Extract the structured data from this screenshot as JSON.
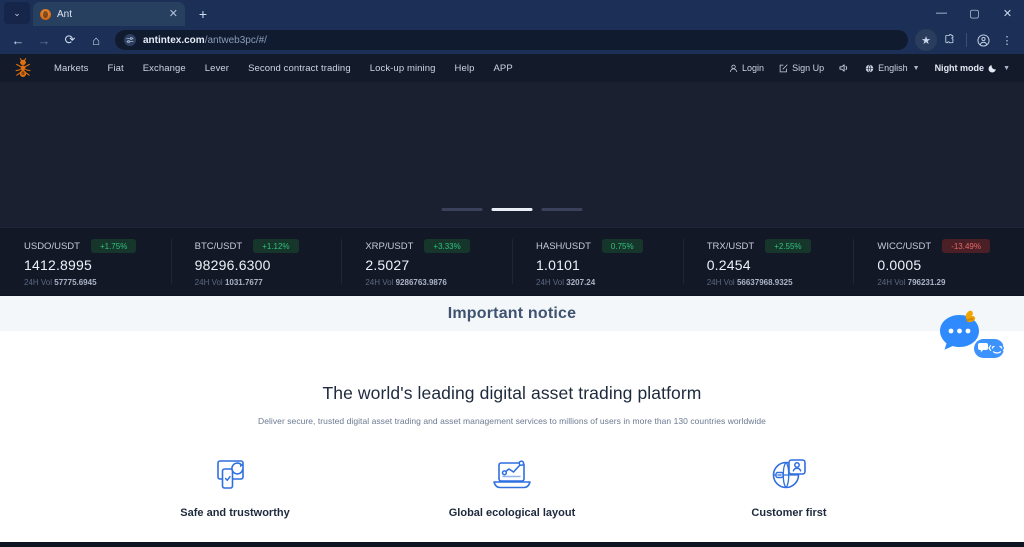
{
  "browser": {
    "tab": {
      "title": "Ant",
      "favicon": "ant-favicon",
      "close": "✕"
    },
    "tab_list_btn": "⌄",
    "new_tab": "+",
    "window_controls": {
      "minimize": "—",
      "maximize": "▢",
      "close": "✕"
    },
    "nav": {
      "back": "←",
      "forward": "→",
      "reload": "⟳",
      "home": "⌂"
    },
    "omnibox": {
      "site_controls_icon": "tune-icon",
      "url_domain": "antintex.com",
      "url_path": "/antweb3pc/#/"
    },
    "toolbar": {
      "bookmark": "★",
      "extensions": "puzzle-icon",
      "profile": "profile-icon",
      "menu": "⋮"
    }
  },
  "site": {
    "logo_alt": "ant-logo",
    "nav_links": [
      "Markets",
      "Fiat",
      "Exchange",
      "Lever",
      "Second contract trading",
      "Lock-up mining",
      "Help",
      "APP"
    ],
    "header_right": {
      "login": "Login",
      "signup": "Sign Up",
      "sound_icon": "speaker-icon",
      "language": "English",
      "night_mode": "Night mode"
    }
  },
  "hero": {
    "carousel": {
      "count": 3,
      "active_index": 1
    }
  },
  "tickers": [
    {
      "pair": "USDO/USDT",
      "change": "+1.75%",
      "direction": "up",
      "price": "1412.8995",
      "vol_label": "24H Vol",
      "vol": "57775.6945"
    },
    {
      "pair": "BTC/USDT",
      "change": "+1.12%",
      "direction": "up",
      "price": "98296.6300",
      "vol_label": "24H Vol",
      "vol": "1031.7677"
    },
    {
      "pair": "XRP/USDT",
      "change": "+3.33%",
      "direction": "up",
      "price": "2.5027",
      "vol_label": "24H Vol",
      "vol": "9286763.9876"
    },
    {
      "pair": "HASH/USDT",
      "change": "0.75%",
      "direction": "up",
      "price": "1.0101",
      "vol_label": "24H Vol",
      "vol": "3207.24"
    },
    {
      "pair": "TRX/USDT",
      "change": "+2.55%",
      "direction": "up",
      "price": "0.2454",
      "vol_label": "24H Vol",
      "vol": "56637968.9325"
    },
    {
      "pair": "WICC/USDT",
      "change": "-13.49%",
      "direction": "down",
      "price": "0.0005",
      "vol_label": "24H Vol",
      "vol": "796231.29"
    }
  ],
  "notice": {
    "title": "Important notice"
  },
  "main": {
    "headline": "The world's leading digital asset trading platform",
    "subhead": "Deliver secure, trusted digital asset trading and asset management services to millions of users in more than 130 countries worldwide",
    "features": [
      {
        "icon": "device-sync-icon",
        "label": "Safe and trustworthy"
      },
      {
        "icon": "laptop-chart-icon",
        "label": "Global ecological layout"
      },
      {
        "icon": "globe-user-icon",
        "label": "Customer first"
      }
    ]
  },
  "chat": {
    "icon": "chat-bubbles-icon"
  },
  "colors": {
    "chrome": "#1c3057",
    "site_header": "#131a29",
    "hero": "#1a2030",
    "ticker_bg": "#121826",
    "notice_bg": "#f3f7fa",
    "up": "#2fc07b",
    "down": "#e66a6a",
    "accent_blue": "#2f6fe0",
    "logo_orange": "#e0700f"
  }
}
